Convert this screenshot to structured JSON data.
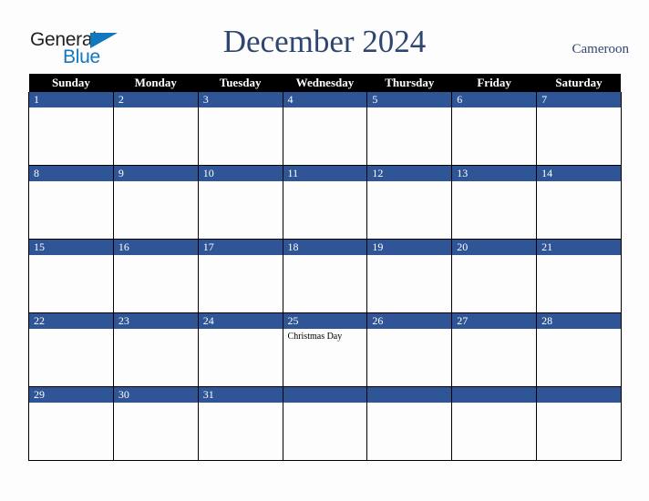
{
  "logo": {
    "word_top": "General",
    "word_bottom": "Blue",
    "triangle_color": "#1278be",
    "text_color": "#231f20"
  },
  "header": {
    "title": "December 2024",
    "country": "Cameroon",
    "title_color": "#2e4670"
  },
  "calendar": {
    "weekday_headers": [
      "Sunday",
      "Monday",
      "Tuesday",
      "Wednesday",
      "Thursday",
      "Friday",
      "Saturday"
    ],
    "header_bg": "#000000",
    "daynum_bg": "#2f5596",
    "cell_bg": "#fdfdfd",
    "weeks": [
      [
        {
          "day": "1",
          "events": []
        },
        {
          "day": "2",
          "events": []
        },
        {
          "day": "3",
          "events": []
        },
        {
          "day": "4",
          "events": []
        },
        {
          "day": "5",
          "events": []
        },
        {
          "day": "6",
          "events": []
        },
        {
          "day": "7",
          "events": []
        }
      ],
      [
        {
          "day": "8",
          "events": []
        },
        {
          "day": "9",
          "events": []
        },
        {
          "day": "10",
          "events": []
        },
        {
          "day": "11",
          "events": []
        },
        {
          "day": "12",
          "events": []
        },
        {
          "day": "13",
          "events": []
        },
        {
          "day": "14",
          "events": []
        }
      ],
      [
        {
          "day": "15",
          "events": []
        },
        {
          "day": "16",
          "events": []
        },
        {
          "day": "17",
          "events": []
        },
        {
          "day": "18",
          "events": []
        },
        {
          "day": "19",
          "events": []
        },
        {
          "day": "20",
          "events": []
        },
        {
          "day": "21",
          "events": []
        }
      ],
      [
        {
          "day": "22",
          "events": []
        },
        {
          "day": "23",
          "events": []
        },
        {
          "day": "24",
          "events": []
        },
        {
          "day": "25",
          "events": [
            "Christmas Day"
          ]
        },
        {
          "day": "26",
          "events": []
        },
        {
          "day": "27",
          "events": []
        },
        {
          "day": "28",
          "events": []
        }
      ],
      [
        {
          "day": "29",
          "events": []
        },
        {
          "day": "30",
          "events": []
        },
        {
          "day": "31",
          "events": []
        },
        {
          "day": "",
          "events": []
        },
        {
          "day": "",
          "events": []
        },
        {
          "day": "",
          "events": []
        },
        {
          "day": "",
          "events": []
        }
      ]
    ]
  }
}
